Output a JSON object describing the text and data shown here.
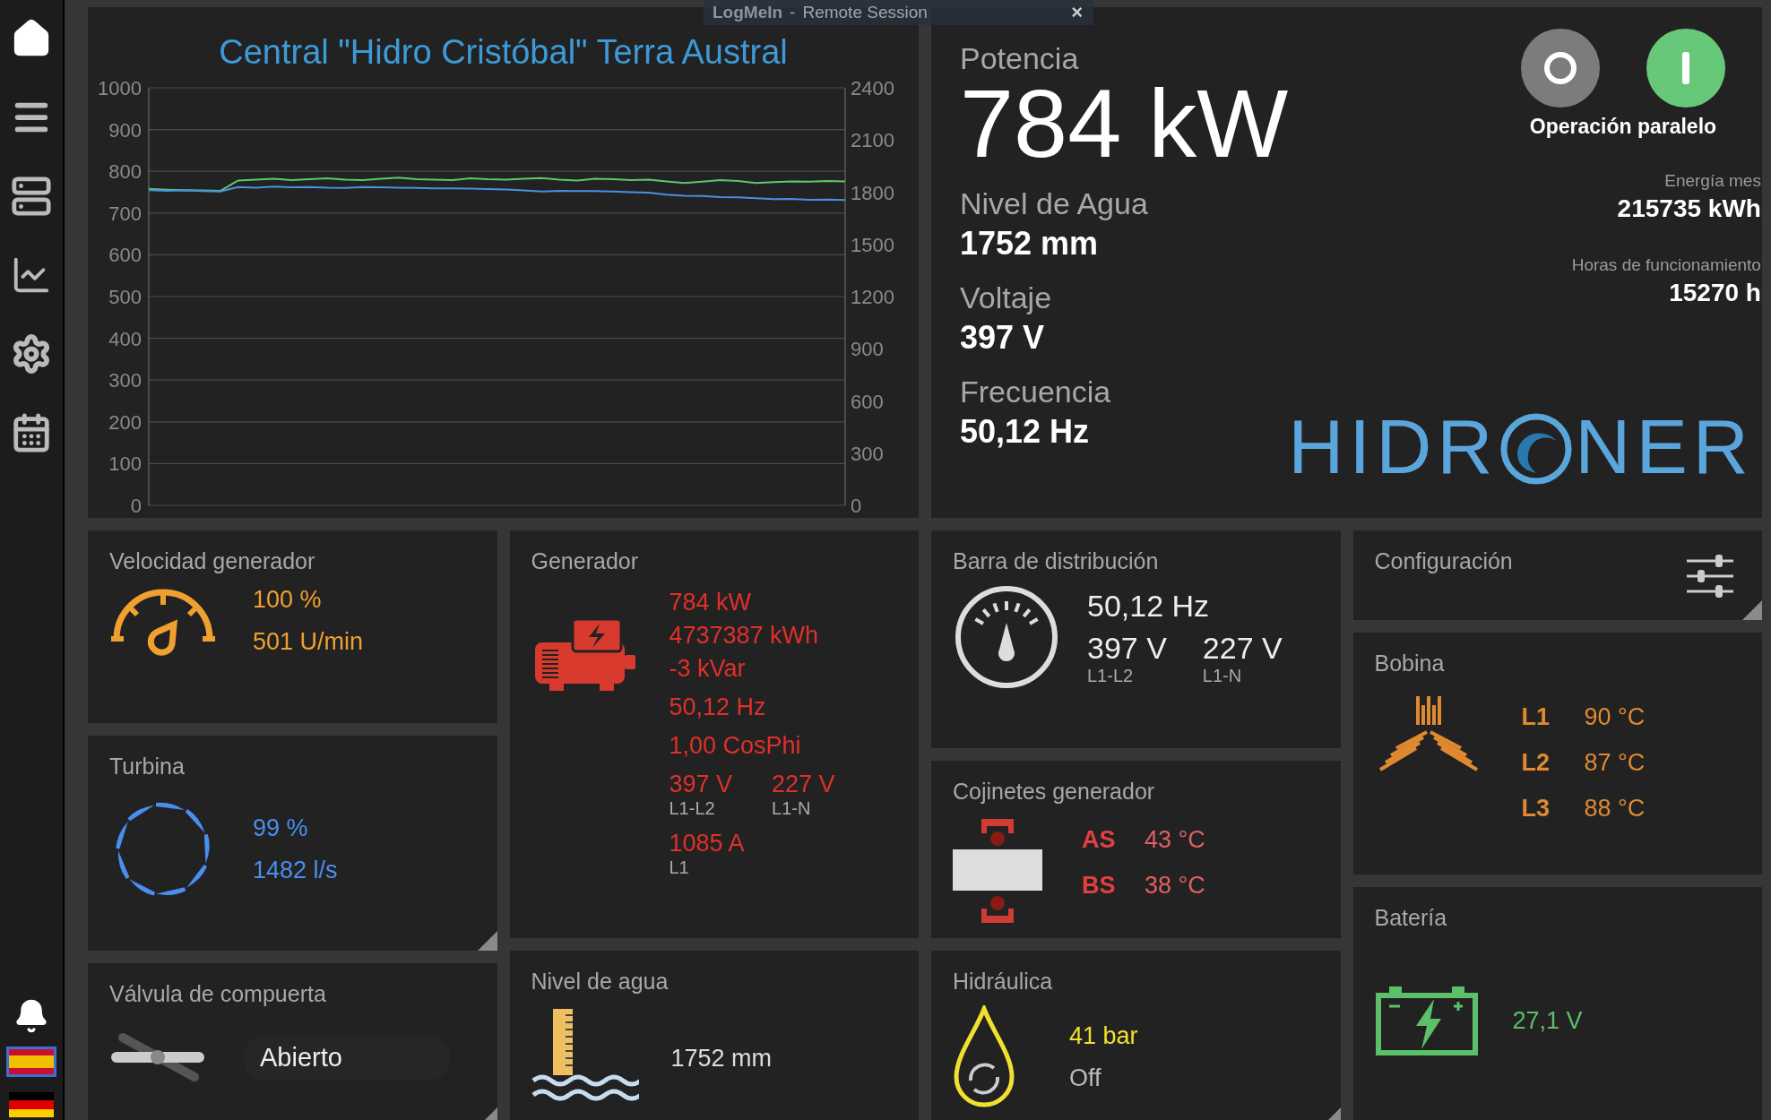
{
  "remote_bar": {
    "title": "LogMeIn",
    "separator": "-",
    "subtitle": "Remote Session",
    "close": "×"
  },
  "languages": [
    {
      "kind": "es",
      "selected": true
    },
    {
      "kind": "de",
      "selected": false
    }
  ],
  "chart_panel": {
    "title": "Central \"Hidro Cristóbal\" Terra Austral",
    "chart_data": {
      "type": "line",
      "grid": true,
      "ylim": [
        0,
        1000
      ],
      "yticks": [
        0,
        100,
        200,
        300,
        400,
        500,
        600,
        700,
        800,
        900,
        1000
      ],
      "y2lim": [
        0,
        2400
      ],
      "y2ticks": [
        0,
        300,
        600,
        900,
        1200,
        1500,
        1800,
        2100,
        2400
      ],
      "series": [
        {
          "color": "#5cc870",
          "values": [
            758,
            756,
            755,
            754,
            753,
            778,
            780,
            782,
            779,
            781,
            783,
            780,
            779,
            782,
            785,
            781,
            780,
            779,
            783,
            781,
            780,
            782,
            784,
            780,
            778,
            782,
            781,
            779,
            780,
            776,
            772,
            775,
            779,
            777,
            772,
            774,
            776,
            775,
            777,
            776
          ]
        },
        {
          "color": "#4a90e0",
          "axis": "y2",
          "values": [
            1812,
            1808,
            1810,
            1806,
            1804,
            1830,
            1826,
            1832,
            1828,
            1830,
            1826,
            1824,
            1830,
            1828,
            1826,
            1824,
            1822,
            1822,
            1820,
            1818,
            1816,
            1810,
            1804,
            1808,
            1806,
            1806,
            1804,
            1800,
            1798,
            1786,
            1780,
            1778,
            1772,
            1770,
            1765,
            1760,
            1762,
            1756,
            1758,
            1755
          ]
        }
      ]
    }
  },
  "summary": {
    "power_label": "Potencia",
    "power": "784 kW",
    "metrics": [
      {
        "label": "Nivel de Agua",
        "value": "1752 mm"
      },
      {
        "label": "Voltaje",
        "value": "397 V"
      },
      {
        "label": "Frecuencia",
        "value": "50,12 Hz"
      }
    ],
    "mode": {
      "label": "Operación paralelo",
      "switches": [
        {
          "kind": "off",
          "active": false
        },
        {
          "kind": "on",
          "active": true
        }
      ]
    },
    "counters": [
      {
        "label": "Energía mes",
        "value": "215735 kWh"
      },
      {
        "label": "Horas de funcionamiento",
        "value": "15270 h"
      }
    ],
    "logo": {
      "before": "HIDR",
      "after": "NER"
    }
  },
  "columns": [
    [
      {
        "kind": "speed",
        "title": "Velocidad generador",
        "values": [
          "100 %",
          "501 U/min"
        ],
        "corner": false
      },
      {
        "kind": "turbine",
        "title": "Turbina",
        "values": [
          "99 %",
          "1482 l/s"
        ],
        "corner": true
      },
      {
        "kind": "valve",
        "title": "Válvula de compuerta",
        "value": "Abierto",
        "corner": true
      }
    ],
    [
      {
        "kind": "generator",
        "title": "Generador",
        "lines": [
          "784 kW",
          "4737387 kWh",
          "-3 kVar"
        ],
        "freq": "50,12 Hz",
        "cosphi": "1,00 CosPhi",
        "voltages": [
          {
            "value": "397 V",
            "phase": "L1-L2"
          },
          {
            "value": "227 V",
            "phase": "L1-N"
          }
        ],
        "current": {
          "value": "1085 A",
          "phase": "L1"
        },
        "corner": false
      },
      {
        "kind": "water",
        "title": "Nivel de agua",
        "value": "1752 mm",
        "corner": false
      }
    ],
    [
      {
        "kind": "busbar",
        "title": "Barra de distribución",
        "freq": "50,12 Hz",
        "voltages": [
          {
            "value": "397 V",
            "phase": "L1-L2"
          },
          {
            "value": "227 V",
            "phase": "L1-N"
          }
        ],
        "corner": false
      },
      {
        "kind": "bearings",
        "title": "Cojinetes generador",
        "rows": [
          {
            "label": "AS",
            "value": "43 °C"
          },
          {
            "label": "BS",
            "value": "38 °C"
          }
        ],
        "corner": false
      },
      {
        "kind": "hydraulic",
        "title": "Hidráulica",
        "pressure": "41 bar",
        "state": "Off",
        "corner": true
      }
    ],
    [
      {
        "kind": "config",
        "title": "Configuración",
        "corner": true
      },
      {
        "kind": "coil",
        "title": "Bobina",
        "rows": [
          {
            "label": "L1",
            "value": "90 °C"
          },
          {
            "label": "L2",
            "value": "87 °C"
          },
          {
            "label": "L3",
            "value": "88 °C"
          }
        ],
        "corner": false
      },
      {
        "kind": "battery",
        "title": "Batería",
        "value": "27,1 V",
        "corner": false
      }
    ]
  ]
}
